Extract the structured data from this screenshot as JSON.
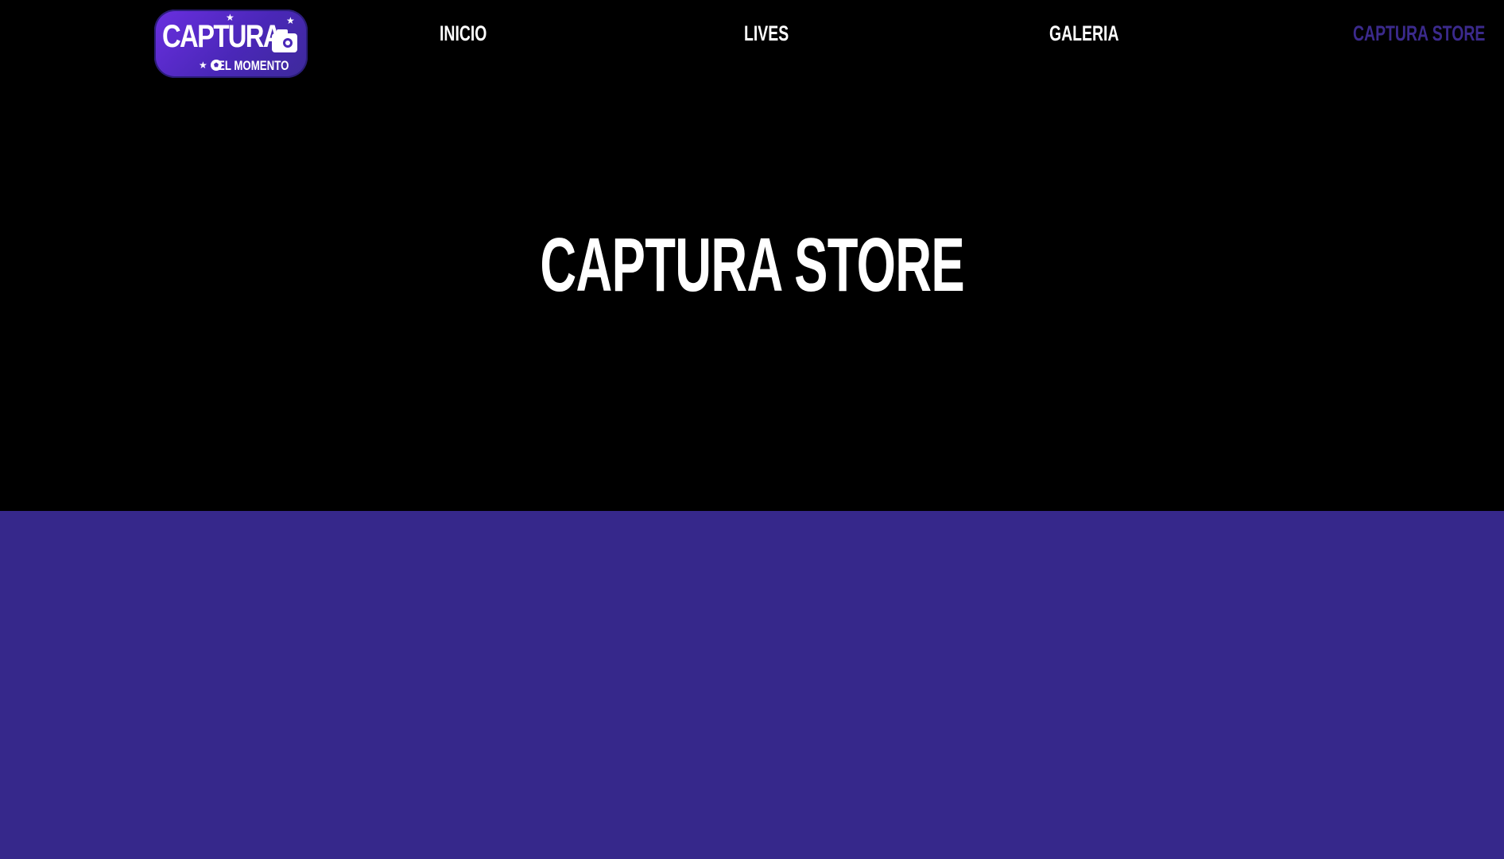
{
  "brand": {
    "logo_main": "CAPTURA",
    "logo_sub": "EL MOMENTO",
    "logo_color": "#5b2fd1"
  },
  "nav": {
    "items": [
      {
        "label": "INICIO",
        "active": false
      },
      {
        "label": "LIVES",
        "active": false
      },
      {
        "label": "GALERIA",
        "active": false
      },
      {
        "label": "CAPTURA STORE",
        "active": true
      }
    ]
  },
  "hero": {
    "title": "CAPTURA STORE"
  },
  "colors": {
    "background": "#000000",
    "text": "#ffffff",
    "accent": "#36288b",
    "active_nav": "#3b2a8c"
  }
}
